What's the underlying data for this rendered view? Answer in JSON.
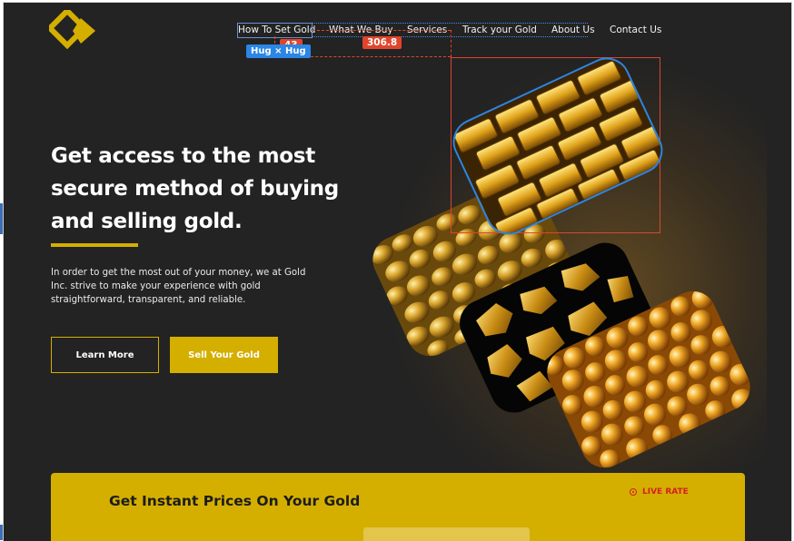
{
  "nav": {
    "items": [
      {
        "label": "How To Set Gold"
      },
      {
        "label": "What We Buy"
      },
      {
        "label": "Services"
      },
      {
        "label": "Track your Gold"
      },
      {
        "label": "About Us"
      },
      {
        "label": "Contact Us"
      }
    ]
  },
  "editor_overlay": {
    "gap_badge": "43",
    "width_badge": "306.8",
    "hug_badge": "Hug × Hug"
  },
  "hero": {
    "headline": "Get access to the most secure method of buying and selling gold.",
    "intro": "In order to get the most out of your money, we at Gold Inc. strive to make your experience with gold straightforward, transparent, and reliable.",
    "learn_more": "Learn More",
    "sell_gold": "Sell Your Gold"
  },
  "prices": {
    "title": "Get Instant Prices On Your Gold",
    "live_label": "LIVE RATE"
  },
  "colors": {
    "background": "#232323",
    "accent_gold": "#d4af00",
    "live_red": "#d32020",
    "selection_blue": "#2b86e6",
    "measure_red": "#e0452b"
  }
}
